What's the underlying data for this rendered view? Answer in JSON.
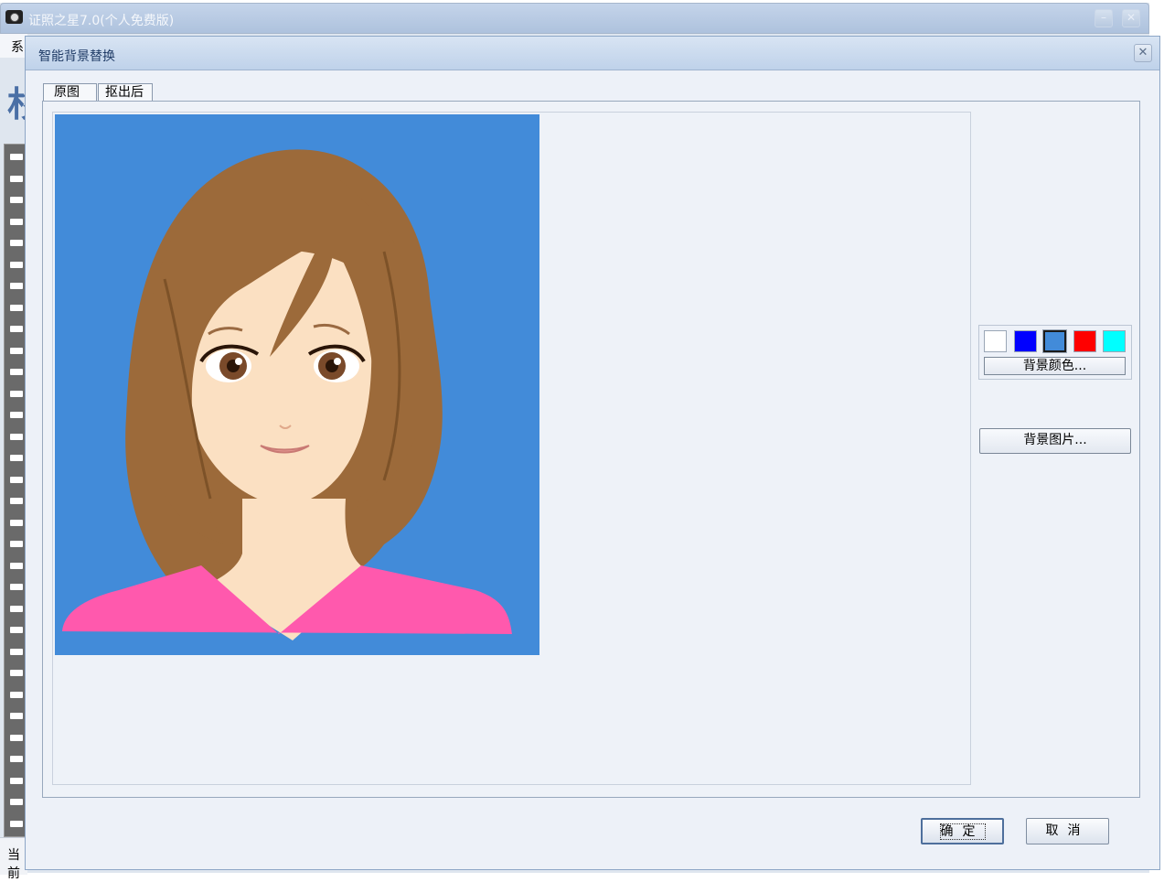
{
  "main_window": {
    "title": "证照之星7.0(个人免费版)",
    "menu_fragment": "系",
    "logo_fragment": "杉",
    "status_fragment": "当前"
  },
  "dialog": {
    "title": "智能背景替换",
    "close_glyph": "✕",
    "tabs": [
      {
        "label": "原图",
        "active": true
      },
      {
        "label": "抠出后",
        "active": false
      }
    ],
    "swatches": [
      {
        "color": "#ffffff",
        "selected": false
      },
      {
        "color": "#0000ff",
        "selected": false
      },
      {
        "color": "#428bd9",
        "selected": true
      },
      {
        "color": "#ff0000",
        "selected": false
      },
      {
        "color": "#00ffff",
        "selected": false
      }
    ],
    "bg_color_button": "背景颜色...",
    "bg_image_button": "背景图片...",
    "ok_button": "确定",
    "cancel_button": "取消"
  },
  "colors": {
    "photo_background": "#428bd9",
    "hair": "#9c6a3a",
    "skin": "#fbe0c2",
    "shirt": "#ff59ad"
  }
}
